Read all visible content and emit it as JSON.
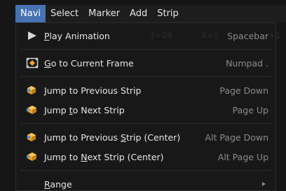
{
  "menubar": {
    "items": [
      {
        "label": "Navi",
        "active": true
      },
      {
        "label": "Select",
        "active": false
      },
      {
        "label": "Marker",
        "active": false
      },
      {
        "label": "Add",
        "active": false
      },
      {
        "label": "Strip",
        "active": false
      }
    ]
  },
  "menu": {
    "play": {
      "label_pre": "",
      "label_ul": "P",
      "label_post": "lay Animation",
      "shortcut": "Spacebar",
      "icon": "play-icon"
    },
    "ghost": [
      "3+08",
      "4+0",
      "+1"
    ],
    "goto": {
      "label_pre": "",
      "label_ul": "G",
      "label_post": "o to Current Frame",
      "shortcut": "Numpad .",
      "icon": "frame-icon"
    },
    "jump_prev": {
      "label_pre": "",
      "label_ul": "J",
      "label_post": "ump to Previous Strip",
      "shortcut": "Page Down",
      "icon": "jump-prev-icon"
    },
    "jump_next": {
      "label_pre": "Jump ",
      "label_ul": "t",
      "label_post": "o Next Strip",
      "shortcut": "Page Up",
      "icon": "jump-next-icon"
    },
    "jump_prev_center": {
      "label_pre": "Jump to Previous ",
      "label_ul": "S",
      "label_post": "trip (Center)",
      "shortcut": "Alt Page Down",
      "icon": "jump-prev-icon"
    },
    "jump_next_center": {
      "label_pre": "Jump to ",
      "label_ul": "N",
      "label_post": "ext Strip (Center)",
      "shortcut": "Alt Page Up",
      "icon": "jump-next-icon"
    },
    "range": {
      "label_pre": "",
      "label_ul": "R",
      "label_post": "ange",
      "icon": "submenu-arrow"
    }
  },
  "colors": {
    "accent": "#4772b3",
    "menu_bg": "#181818",
    "text": "#e6e6e6",
    "shortcut": "#8a8a8a"
  }
}
